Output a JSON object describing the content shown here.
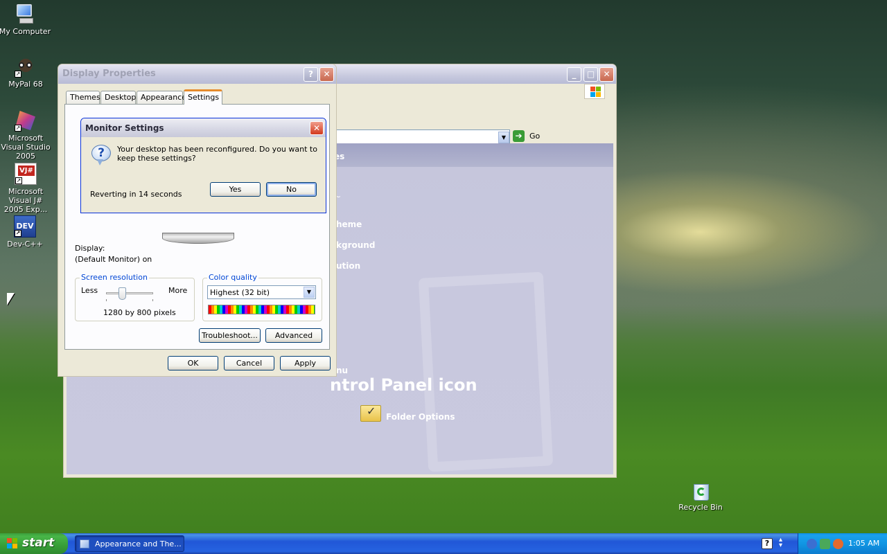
{
  "desktop": {
    "icons": [
      {
        "label": "My Computer",
        "icon": "computer-icon"
      },
      {
        "label": "MyPal 68",
        "icon": "mypal-icon"
      },
      {
        "label": "Microsoft Visual Studio 2005",
        "icon": "visual-studio-icon"
      },
      {
        "label": "Microsoft Visual J# 2005 Exp...",
        "icon": "visual-j-sharp-icon"
      },
      {
        "label": "Dev-C++",
        "icon": "dev-cpp-icon"
      },
      {
        "label": "Recycle Bin",
        "icon": "recycle-bin-icon"
      }
    ],
    "dev_badge": "DEV",
    "vj_badge": "VJ#"
  },
  "control_panel": {
    "go_label": "Go",
    "partial_links": [
      "es",
      "~",
      "heme",
      "kground",
      "ution",
      "nu"
    ],
    "heading_partial": "ntrol Panel icon",
    "folder_options_label": "Folder Options"
  },
  "display_properties": {
    "title": "Display Properties",
    "tabs": [
      "Themes",
      "Desktop",
      "Appearance",
      "Settings"
    ],
    "active_tab": "Settings",
    "display_label": "Display:",
    "display_value": "(Default Monitor) on",
    "screen_resolution": {
      "title": "Screen resolution",
      "less": "Less",
      "more": "More",
      "value": "1280 by 800 pixels"
    },
    "color_quality": {
      "title": "Color quality",
      "selected": "Highest (32 bit)"
    },
    "buttons": {
      "troubleshoot": "Troubleshoot...",
      "advanced": "Advanced",
      "ok": "OK",
      "cancel": "Cancel",
      "apply": "Apply"
    }
  },
  "monitor_settings": {
    "title": "Monitor Settings",
    "message": "Your desktop has been reconfigured.  Do you want to keep these settings?",
    "countdown": "Reverting in 14 seconds",
    "yes_label": "Yes",
    "no_label": "No"
  },
  "taskbar": {
    "start_label": "start",
    "task_label": "Appearance and The...",
    "clock": "1:05 AM",
    "help_glyph": "?"
  }
}
